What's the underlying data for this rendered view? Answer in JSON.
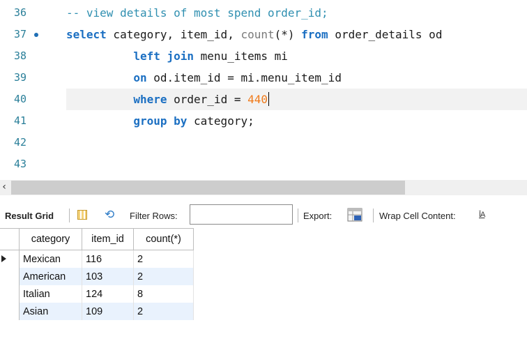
{
  "editor": {
    "lines": [
      {
        "num": "36"
      },
      {
        "num": "37"
      },
      {
        "num": "38"
      },
      {
        "num": "39"
      },
      {
        "num": "40"
      },
      {
        "num": "41"
      },
      {
        "num": "42"
      },
      {
        "num": "43"
      }
    ],
    "tokens": {
      "comment": "-- view details of most spend order_id;",
      "select": "select",
      "select_cols": " category, item_id, ",
      "count_fn": "count",
      "count_args": "(*) ",
      "from": "from",
      "from_table": " order_details od",
      "left_join": "left join",
      "join_table": " menu_items mi",
      "on": "on",
      "on_cond": " od.item_id = mi.menu_item_id",
      "where": "where",
      "where_cond": " order_id = ",
      "where_value": "440",
      "group_by": "group by",
      "group_col": " category;"
    }
  },
  "toolbar": {
    "result_grid": "Result Grid",
    "filter_rows": "Filter Rows:",
    "filter_value": "",
    "export": "Export:",
    "wrap_cell": "Wrap Cell Content:",
    "wrap_icon_label": "ĪA"
  },
  "grid": {
    "columns": [
      "category",
      "item_id",
      "count(*)"
    ],
    "rows": [
      [
        "Mexican",
        "116",
        "2"
      ],
      [
        "American",
        "103",
        "2"
      ],
      [
        "Italian",
        "124",
        "8"
      ],
      [
        "Asian",
        "109",
        "2"
      ]
    ]
  },
  "colors": {
    "keyword": "#1b6fc2",
    "comment": "#2f8fb0",
    "number": "#f07a1a",
    "line_number": "#2a7f99",
    "row_alt": "#e9f2fd"
  }
}
